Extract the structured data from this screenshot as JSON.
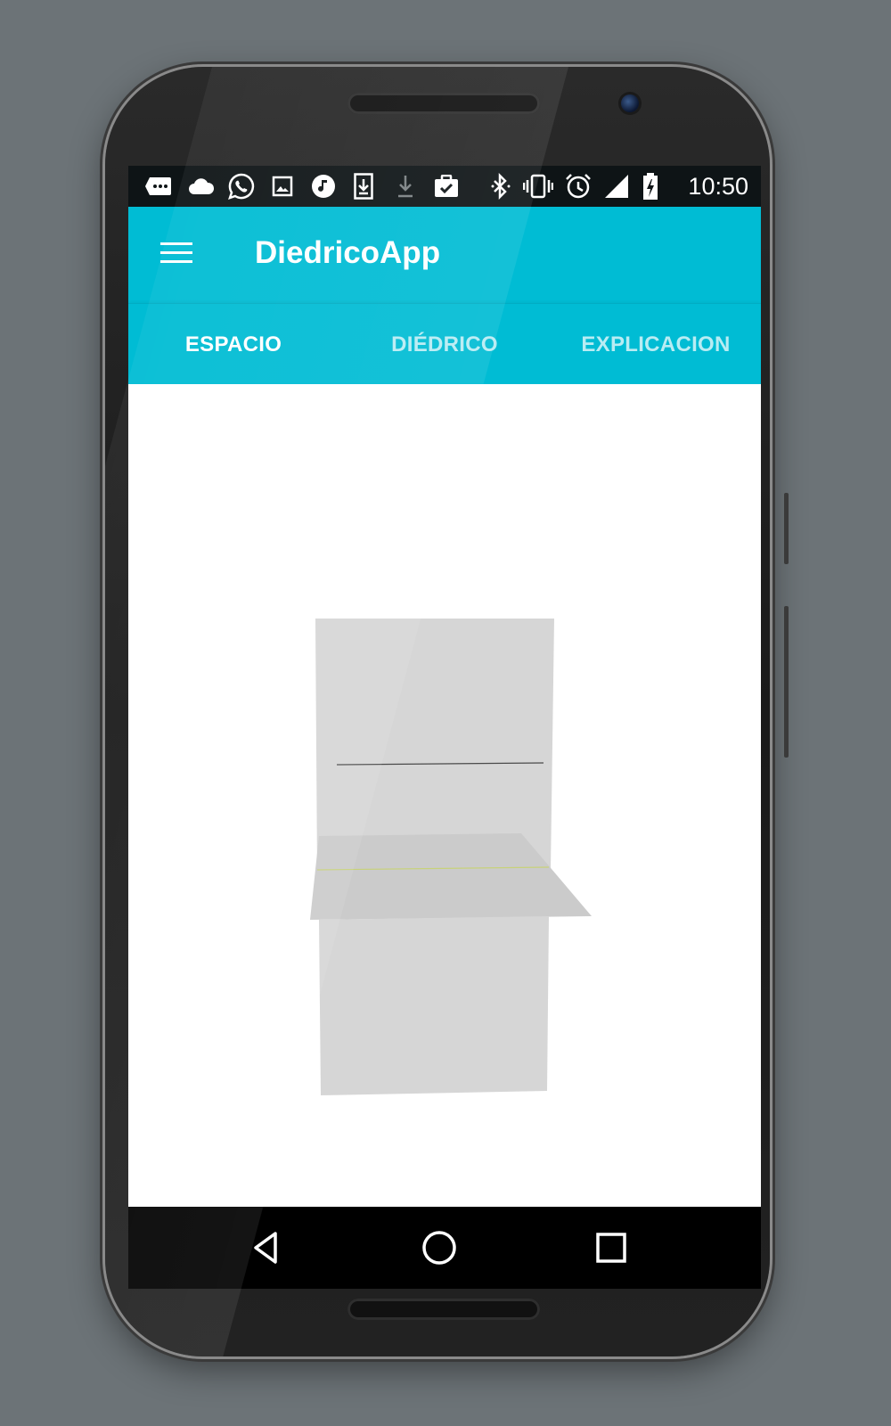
{
  "status_bar": {
    "time": "10:50",
    "icons": [
      "message-icon",
      "cloud-icon",
      "whatsapp-icon",
      "image-icon",
      "music-icon",
      "download-icon",
      "download-icon",
      "clipboard-check-icon",
      "bluetooth-icon",
      "vibrate-icon",
      "alarm-icon",
      "signal-icon",
      "battery-charging-icon"
    ]
  },
  "app_bar": {
    "title": "DiedricoApp",
    "menu_icon": "menu-icon"
  },
  "tabs": [
    {
      "label": "ESPACIO",
      "active": true
    },
    {
      "label": "DIÉDRICO",
      "active": false
    },
    {
      "label": "EXPLICACION",
      "active": false
    }
  ],
  "nav_bar": {
    "back_icon": "back-triangle-icon",
    "home_icon": "home-circle-icon",
    "recents_icon": "recents-square-icon"
  },
  "colors": {
    "accent": "#00bcd4",
    "status_bar": "#0e1416",
    "plane_fill": "#d6d6d6",
    "ground_line": "#c8d27a"
  }
}
